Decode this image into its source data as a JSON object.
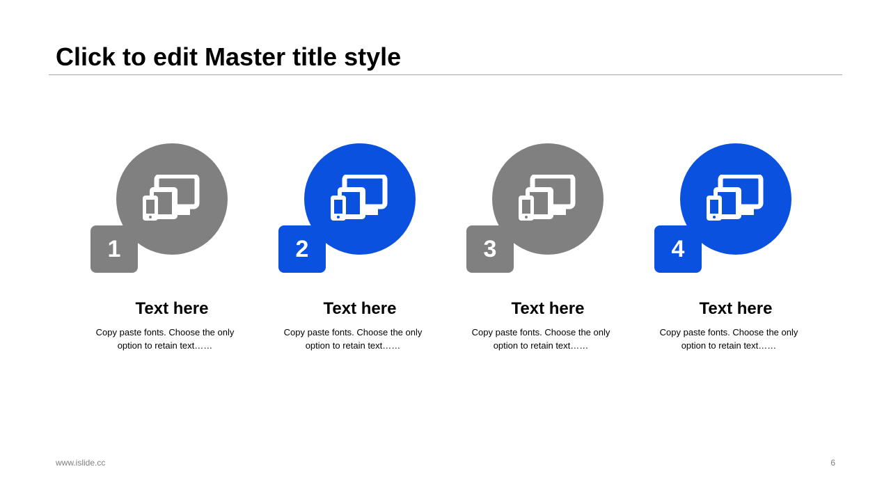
{
  "slide": {
    "title": "Click to edit Master title style",
    "footer_url": "www.islide.cc",
    "page_number": "6"
  },
  "colors": {
    "gray": "#808080",
    "blue": "#0b51e0"
  },
  "items": [
    {
      "number": "1",
      "heading": "Text here",
      "description": "Copy paste fonts. Choose the only option to retain text……",
      "color": "#808080",
      "icon": "devices-icon"
    },
    {
      "number": "2",
      "heading": "Text here",
      "description": "Copy paste fonts. Choose the only option to retain text……",
      "color": "#0b51e0",
      "icon": "devices-icon"
    },
    {
      "number": "3",
      "heading": "Text here",
      "description": "Copy paste fonts. Choose the only option to retain text……",
      "color": "#808080",
      "icon": "devices-icon"
    },
    {
      "number": "4",
      "heading": "Text here",
      "description": "Copy paste fonts. Choose the only option to retain text……",
      "color": "#0b51e0",
      "icon": "devices-icon"
    }
  ]
}
